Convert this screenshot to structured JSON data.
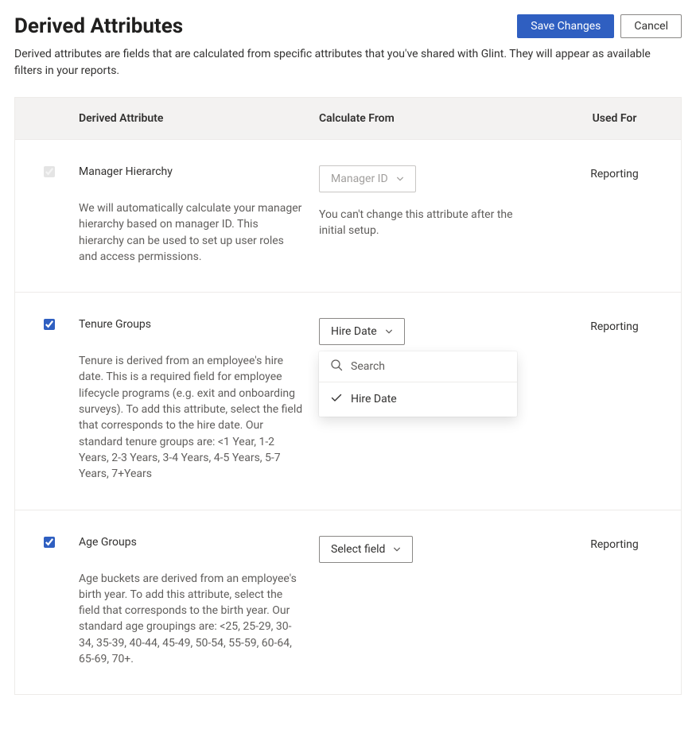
{
  "header": {
    "title": "Derived Attributes",
    "save_label": "Save Changes",
    "cancel_label": "Cancel",
    "subtitle": "Derived attributes are fields that are calculated from specific attributes that you've shared with Glint. They will appear as available filters in your reports."
  },
  "table": {
    "columns": {
      "attribute": "Derived Attribute",
      "calculate": "Calculate From",
      "used": "Used For"
    }
  },
  "rows": [
    {
      "checked": true,
      "disabled": true,
      "title": "Manager Hierarchy",
      "description": "We will automatically calculate your manager hierarchy based on manager ID. This hierarchy can be used to set up user roles and access permissions.",
      "select_label": "Manager ID",
      "select_disabled": true,
      "calc_note": "You can't change this attribute after the initial setup.",
      "used_for": "Reporting"
    },
    {
      "checked": true,
      "disabled": false,
      "title": "Tenure Groups",
      "description": "Tenure is derived from an employee's hire date. This is a required field for employee lifecycle programs (e.g. exit and onboarding surveys). To add this attribute, select the field that corresponds to the hire date.\nOur standard tenure groups are: <1 Year, 1-2 Years, 2-3 Years, 3-4 Years, 4-5 Years, 5-7 Years, 7+Years",
      "select_label": "Hire Date",
      "select_disabled": false,
      "used_for": "Reporting",
      "dropdown": {
        "search_placeholder": "Search",
        "options": [
          {
            "label": "Hire Date",
            "selected": true
          }
        ]
      }
    },
    {
      "checked": true,
      "disabled": false,
      "title": "Age Groups",
      "description": "Age buckets are derived from an employee's birth year. To add this attribute, select the field that corresponds to the birth year.\nOur standard age groupings are: <25, 25-29, 30-34, 35-39, 40-44, 45-49, 50-54, 55-59, 60-64, 65-69, 70+.",
      "select_label": "Select field",
      "select_disabled": false,
      "used_for": "Reporting"
    }
  ]
}
